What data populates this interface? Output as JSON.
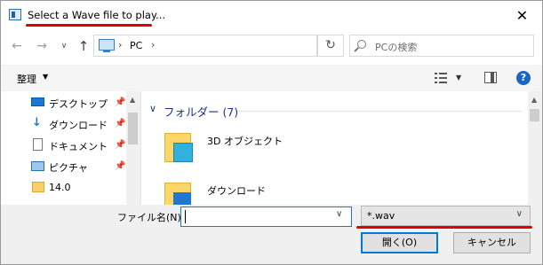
{
  "window": {
    "title": "Select a Wave file to play...",
    "close_glyph": "✕"
  },
  "nav": {
    "back_glyph": "←",
    "forward_glyph": "→",
    "recent_glyph": "∨",
    "up_glyph": "↑",
    "breadcrumb": [
      "PC"
    ],
    "separator": "›",
    "refresh_glyph": "↻",
    "search_placeholder": "PCの検索"
  },
  "toolbar": {
    "organize_label": "整理",
    "organize_caret": "▼",
    "view_caret": "▼",
    "help_glyph": "?"
  },
  "sidebar": {
    "pin_glyph": "📌",
    "items": [
      {
        "label": "デスクトップ",
        "icon": "desktop-icon",
        "pinned": true
      },
      {
        "label": "ダウンロード",
        "icon": "download-icon",
        "pinned": true
      },
      {
        "label": "ドキュメント",
        "icon": "document-icon",
        "pinned": true
      },
      {
        "label": "ピクチャ",
        "icon": "picture-icon",
        "pinned": true
      },
      {
        "label": "14.0",
        "icon": "folder-icon",
        "pinned": false
      }
    ]
  },
  "content": {
    "group_caret": "∨",
    "group_title": "フォルダー (7)",
    "folders": [
      {
        "label": "3D オブジェクト",
        "icon": "3d-objects-folder-icon"
      },
      {
        "label": "ダウンロード",
        "icon": "downloads-folder-icon"
      }
    ]
  },
  "scroll": {
    "up_glyph": "▲"
  },
  "bottom": {
    "filename_label": "ファイル名(N):",
    "filename_value": "",
    "dropdown_glyph": "∨",
    "filetype_value": "*.wav",
    "open_label": "開く(O)",
    "cancel_label": "キャンセル"
  },
  "colors": {
    "annotation_red": "#e00000",
    "focus_blue": "#0078d7",
    "group_header_blue": "#1e3287"
  }
}
